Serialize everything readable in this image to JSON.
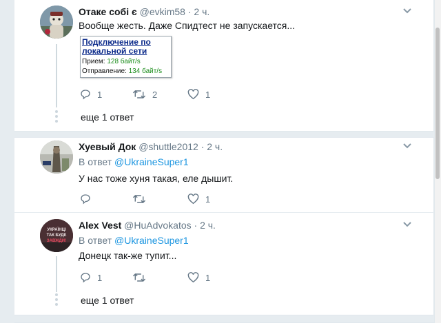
{
  "tweets": [
    {
      "name": "Отаке собі є",
      "handle": "@evkim58",
      "time": "· 2 ч.",
      "text": "Вообще жесть. Даже Спидтест не запускается...",
      "media": {
        "title": "Подключение по локальной сети",
        "title_line1": "Подключение по",
        "title_line2": "локальной сети",
        "recv_label": "Прием:",
        "recv_value": "128 байт/s",
        "send_label": "Отправление:",
        "send_value": "134 байт/s"
      },
      "replies": "1",
      "retweets": "2",
      "likes": "1",
      "more_replies": "еще 1 ответ"
    },
    {
      "name": "Хуевый Док",
      "handle": "@shuttle2012",
      "time": "· 2 ч.",
      "reply_prefix": "В ответ",
      "reply_to": "@UkraineSuper1",
      "text": "У нас тоже хуня такая, еле дышит.",
      "replies": "",
      "retweets": "",
      "likes": "1"
    },
    {
      "name": "Alex Vest",
      "handle": "@HuAdvokatos",
      "time": "· 2 ч.",
      "reply_prefix": "В ответ",
      "reply_to": "@UkraineSuper1",
      "text": "Донецк так-же тупит...",
      "replies": "1",
      "retweets": "",
      "likes": "1",
      "more_replies": "еще 1 ответ",
      "avatar_text": [
        "УКРАЇНЦІ",
        "ТАК БУДЕ",
        "ЗАВЖДИ!"
      ]
    }
  ],
  "icons": {
    "reply": "reply-icon",
    "retweet": "retweet-icon",
    "like": "heart-icon",
    "caret": "chevron-down-icon"
  },
  "colors": {
    "secondary_text": "#657786",
    "link": "#1b95e0",
    "background": "#e6ecf0"
  }
}
